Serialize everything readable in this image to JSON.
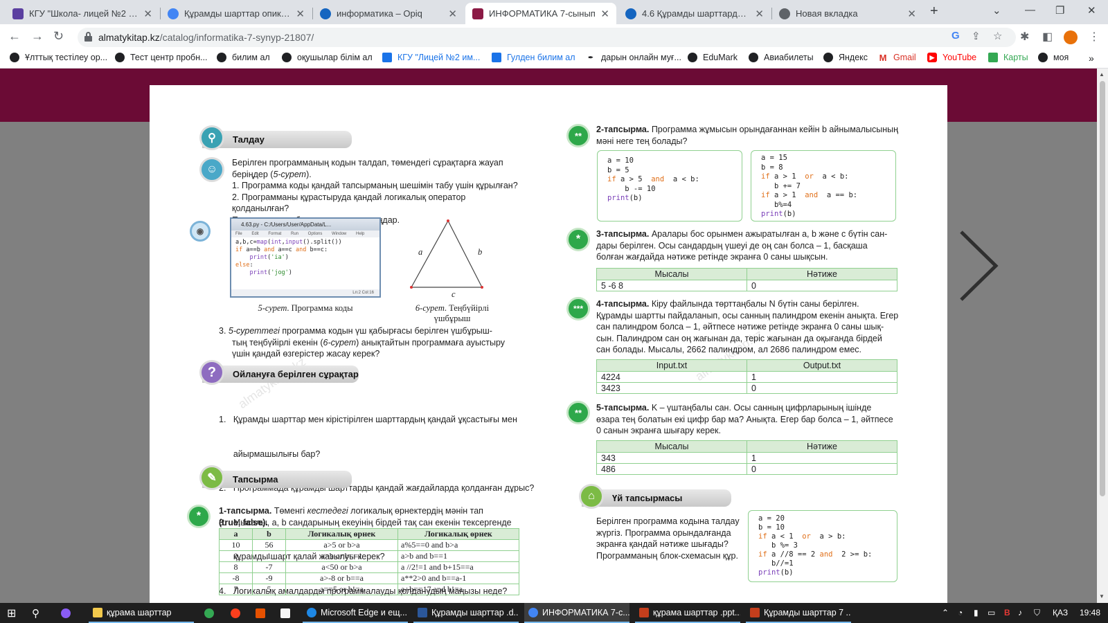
{
  "browser": {
    "tabs": [
      {
        "title": "КГУ \"Школа- лицей №2 имени",
        "color": "#5b3fa0"
      },
      {
        "title": "Құрамды шарттар опик - Поиск",
        "color": "#4285f4"
      },
      {
        "title": "информатика – Opiq",
        "color": "#1565c0"
      },
      {
        "title": "ИНФОРМАТИКА 7-сынып",
        "color": "#8b1a45"
      },
      {
        "title": "4.6 Құрамды шарттарды пр",
        "color": "#1565c0"
      },
      {
        "title": "Новая вкладка",
        "color": "#5f6368"
      }
    ],
    "url_domain": "almatykitap.kz",
    "url_path": "/catalog/informatika-7-synyp-21807/",
    "bookmarks": [
      {
        "label": "Ұлттық тестілеу ор...",
        "color": "#202124"
      },
      {
        "label": "Тест центр пробн...",
        "color": "#202124"
      },
      {
        "label": "билим ал",
        "color": "#202124"
      },
      {
        "label": "оқушылар білім ал",
        "color": "#202124"
      },
      {
        "label": "КГУ \"Лицей №2 им...",
        "color": "#1a73e8"
      },
      {
        "label": "Гулден билим ал",
        "color": "#1a73e8"
      },
      {
        "label": "дарын онлайн муғ...",
        "color": "#202124"
      },
      {
        "label": "EduMark",
        "color": "#202124"
      },
      {
        "label": "Авиабилеты",
        "color": "#202124"
      },
      {
        "label": "Яндекс",
        "color": "#202124"
      },
      {
        "label": "Gmail",
        "color": "#d93025"
      },
      {
        "label": "YouTube",
        "color": "#ff0000"
      },
      {
        "label": "Карты",
        "color": "#34a853"
      },
      {
        "label": "моя",
        "color": "#202124"
      }
    ]
  },
  "left": {
    "analysis_title": "Талдау",
    "analysis_intro_a": "Берілген программаның кодын талдап, төмендегі сұрақтарға жауап",
    "analysis_intro_b": "беріңдер (",
    "analysis_intro_ref": "5-сурет",
    "analysis_intro_c": ").",
    "analysis_q1": "1. Программа коды қандай тапсырманың шешімін табу үшін құрылған?",
    "analysis_q2": "2. Программаны құрастыруда қандай логикалық оператор қолданылған?",
    "analysis_q2b": "Программаның блок-схемасын құрыңдар.",
    "idle_title": "4.63.py - C:/Users/User/AppData/L...",
    "idle_menu": "File Edit Format Run Options Window Help",
    "idle_status": "Ln:2   Col:16",
    "fig5_ref": "5-сурет",
    "fig5_text": ". Программа коды",
    "fig6_ref": "6-сурет",
    "fig6_text": ". Теңбүйірлі",
    "fig6_text2": "үшбұрыш",
    "tri_a": "a",
    "tri_b": "b",
    "tri_c": "c",
    "item3_num": "3.",
    "item3_ref": "5-суреттегі",
    "item3_a": " программа кодын үш қабырғасы берілген үшбұрыш-",
    "item3_b": "тың теңбүйірлі екенін (",
    "item3_ref2": "6-сурет",
    "item3_c": ") анықтайтын программаға ауыстыру",
    "item3_d": "үшін қандай өзгерістер жасау керек?",
    "think_title": "Ойлануға берілген сұрақтар",
    "think_items": [
      "1.   Құрамды шарттар мен кірістірілген шарттардың қандай ұқсастығы мен",
      "      айырмашылығы бар?",
      "2.   Программада құрамды шарттарды қандай жағдайларда қолданған дұрыс?",
      "3.   Мысалы, a, b сандарының екеуінің бірдей тақ сан екенін тексергенде",
      "      құрамды шарт қалай жазылуы керек?",
      "4.   Логикалық амалдарды программалауды қолданудың маңызы неде?"
    ],
    "task_title": "Тапсырма",
    "task1_label": "1-тапсырма.",
    "task1_a": " Төменгі ",
    "task1_ref": "кестедегі",
    "task1_b": " логикалық өрнектердің мәнін тап",
    "task1_c": "(true, false).",
    "truth_headers": [
      "a",
      "b",
      "Логикалық өрнек",
      "Логикалық өрнек"
    ],
    "truth_rows": [
      [
        "10",
        "56",
        "a>5 or b>a",
        "a%5==0 and b>a"
      ],
      [
        "0",
        "1",
        "a>b or b==1",
        "a>b and b==1"
      ],
      [
        "8",
        "-7",
        "a<50 or b>a",
        "a //2!=1 and b+15==a"
      ],
      [
        "-8",
        "-9",
        "a>-8 or b==a",
        "a**2>0 and b==a-1"
      ],
      [
        "7",
        "5",
        "a==5 or b!=a",
        "a+b==17 and b!=a"
      ]
    ]
  },
  "right": {
    "task2_label": "2-тапсырма.",
    "task2_a": " Программа жұмысын орындағаннан кейін b айнымалысының",
    "task2_b": "мәні неге тең болады?",
    "task3_label": "3-тапсырма.",
    "task3_lines": [
      " Аралары бос орынмен ажыратылған a, b және c бүтін сан-",
      "дары берілген. Осы сандардың үшеуі де оң сан болса – 1, басқаша",
      "болған жағдайда нәтиже ретінде экранға 0 саны шықсын."
    ],
    "task3_headers": [
      "Мысалы",
      "Нәтиже"
    ],
    "task3_rows": [
      [
        "5 -6 8",
        "0"
      ]
    ],
    "task4_label": "4-тапсырма.",
    "task4_lines": [
      " Кіру файлында төрттаңбалы N бүтін саны берілген.",
      "Құрамды шартты пайдаланып, осы санның палиндром екенін анықта. Егер",
      "сан палиндром болса – 1, әйтпесе нәтиже ретінде экранға 0 саны шық-",
      "сын. Палиндром сан оң жағынан да, теріс жағынан да оқығанда бірдей",
      "сан болады. Мысалы, 2662 палиндром, ал 2686 палиндром емес."
    ],
    "task4_headers": [
      "Input.txt",
      "Output.txt"
    ],
    "task4_rows": [
      [
        "4224",
        "1"
      ],
      [
        "3423",
        "0"
      ]
    ],
    "task5_label": "5-тапсырма.",
    "task5_lines": [
      " K – үштаңбалы сан. Осы санның цифрларының ішінде",
      "өзара тең болатын екі цифр бар ма? Анықта. Егер бар болса – 1, әйтпесе",
      "0 санын экранға шығару керек."
    ],
    "task5_headers": [
      "Мысалы",
      "Нәтиже"
    ],
    "task5_rows": [
      [
        "343",
        "1"
      ],
      [
        "486",
        "0"
      ]
    ],
    "home_title": "Үй тапсырмасы",
    "home_lines": [
      "Берілген программа кодына талдау",
      "жүргіз. Программа орындалғанда",
      "экранға қандай нәтиже шығады?",
      "Программаның блок-схемасын құр."
    ]
  },
  "watermarks": [
    "almatykitap.kz",
    "almatykitap.kz"
  ],
  "taskbar": {
    "items": [
      {
        "label": "құрама шарттар",
        "color": "#f2c94c"
      },
      {
        "label": "Microsoft Edge и ещ...",
        "color": "#1e88e5"
      },
      {
        "label": "Құрамды шарттар .d...",
        "color": "#2b579a"
      },
      {
        "label": "ИНФОРМАТИКА 7-с...",
        "color": "#4285f4"
      },
      {
        "label": "құрама шарттар .ppt...",
        "color": "#c43e1c"
      },
      {
        "label": "Құрамды шарттар 7 ...",
        "color": "#c43e1c"
      }
    ],
    "lang": "ҚАЗ",
    "time": "19:48"
  }
}
